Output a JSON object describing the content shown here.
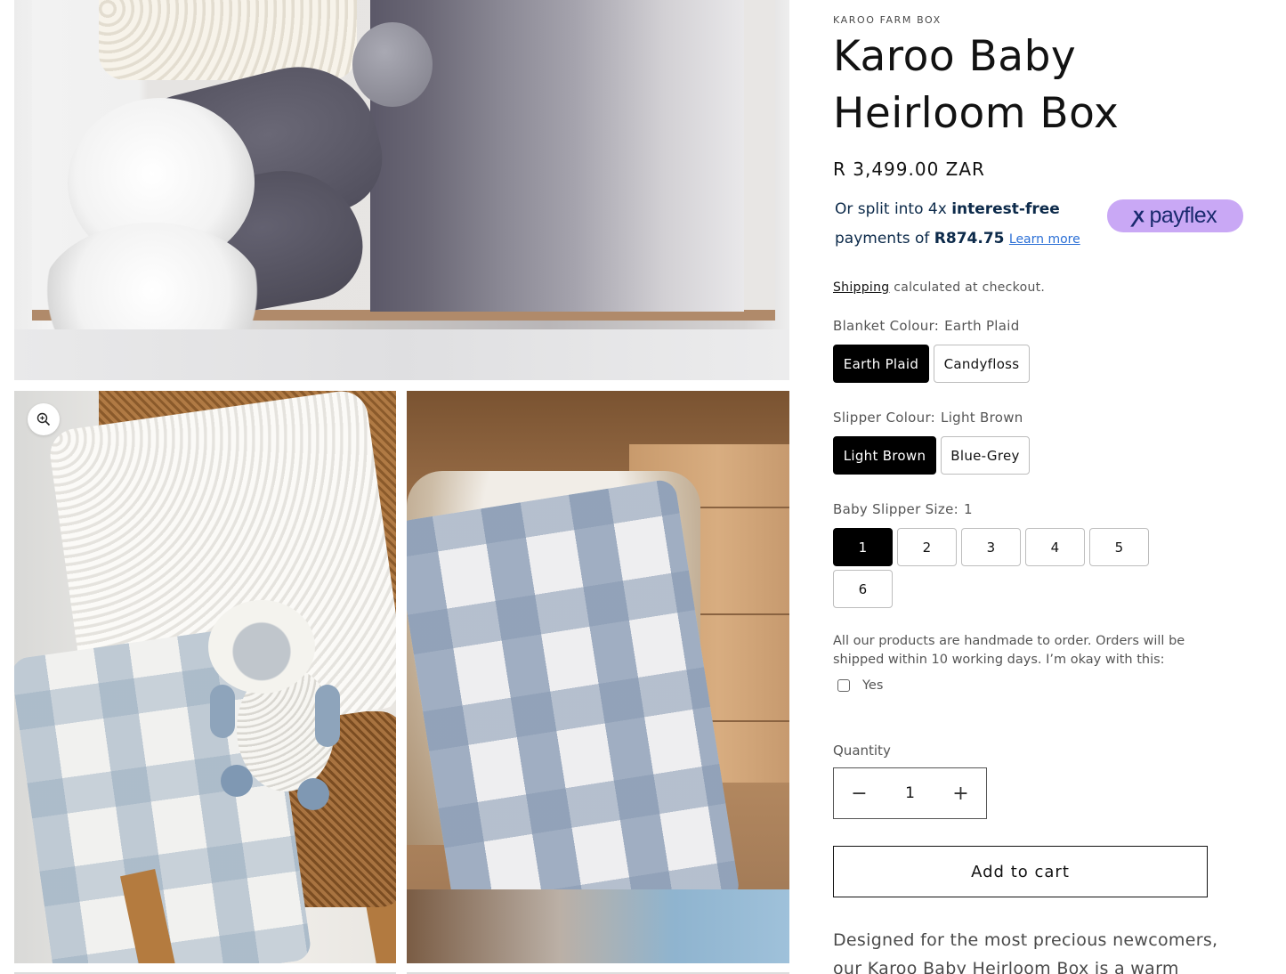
{
  "product": {
    "vendor": "KAROO FARM BOX",
    "title": "Karoo Baby Heirloom Box",
    "price": "R 3,499.00 ZAR"
  },
  "payflex": {
    "line1_prefix": "Or split into 4x ",
    "line1_bold": "interest-free",
    "line2_prefix": "payments of ",
    "line2_bold": "R874.75",
    "learn_more": "Learn more",
    "logo_text": "payflex",
    "logo_mark": "ꭗ",
    "brand_color": "#c9a8f5"
  },
  "shipping": {
    "link": "Shipping",
    "text": " calculated at checkout."
  },
  "options": {
    "blanket": {
      "label": "Blanket Colour:",
      "value": "Earth Plaid",
      "choices": [
        "Earth Plaid",
        "Candyfloss"
      ]
    },
    "slipper": {
      "label": "Slipper Colour:",
      "value": "Light Brown",
      "choices": [
        "Light Brown",
        "Blue-Grey"
      ]
    },
    "size": {
      "label": "Baby Slipper Size:",
      "value": "1",
      "choices": [
        "1",
        "2",
        "3",
        "4",
        "5",
        "6"
      ]
    }
  },
  "handmade": {
    "note": "All our products are handmade to order. Orders will be shipped within 10 working days. I’m okay with this:",
    "yes": "Yes"
  },
  "quantity": {
    "label": "Quantity",
    "value": "1",
    "minus": "−",
    "plus": "+"
  },
  "cart": {
    "button": "Add to cart"
  },
  "description": "Designed for the most precious newcomers, our Karoo Baby Heirloom Box is a warm welcome",
  "icons": {
    "zoom": "zoom-in-icon"
  }
}
